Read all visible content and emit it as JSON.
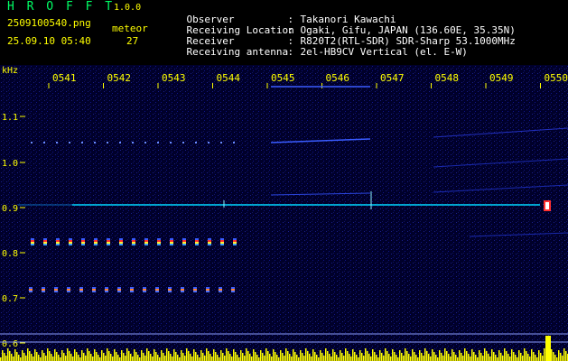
{
  "header": {
    "brand": "H R O F F T",
    "version": "1.0.0",
    "filename": "2509100540.png",
    "datetime": "25.09.10 05:40",
    "meteor_label": "meteor",
    "meteor_count": "27"
  },
  "info": [
    {
      "key": "Observer",
      "value": "Takanori Kawachi"
    },
    {
      "key": "Receiving Location",
      "value": "Ogaki, Gifu, JAPAN (136.60E, 35.35N)"
    },
    {
      "key": "Receiver",
      "value": "R820T2(RTL-SDR) SDR-Sharp 53.1000MHz"
    },
    {
      "key": "Receiving antenna",
      "value": "2el-HB9CV Vertical (el. E-W)"
    }
  ],
  "axis": {
    "unit": "kHz",
    "time_ticks": [
      "0541",
      "0542",
      "0543",
      "0544",
      "0545",
      "0546",
      "0547",
      "0548",
      "0549",
      "0550"
    ],
    "freq_ticks": [
      "1.1",
      "1.0",
      "0.9",
      "0.8",
      "0.7",
      "0.6"
    ]
  },
  "colors": {
    "label": "#ffff00",
    "brand": "#00ff66",
    "text": "#ffffff",
    "background": "#00002a",
    "carrier": "#00d8ff"
  }
}
